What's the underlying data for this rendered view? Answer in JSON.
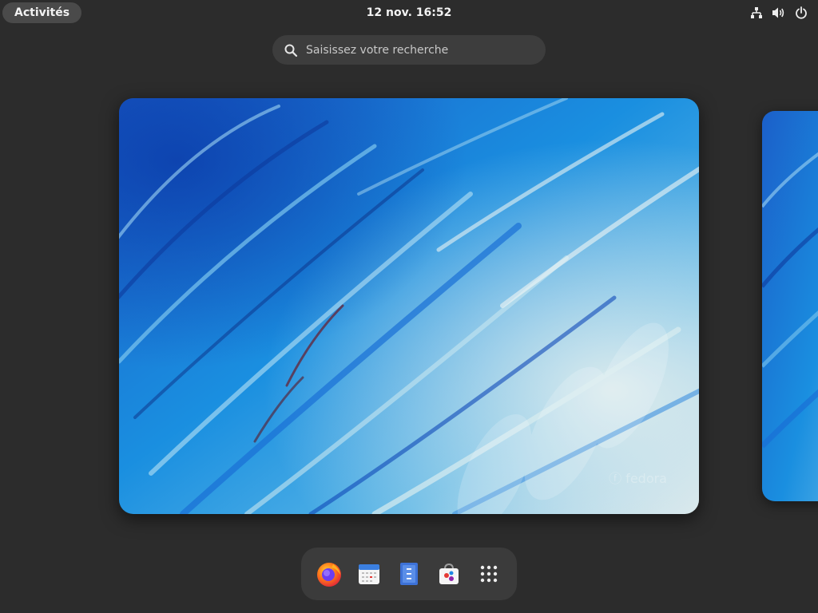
{
  "topbar": {
    "activities_label": "Activités",
    "clock": "12 nov.  16:52",
    "tray_icons": [
      "network-icon",
      "volume-icon",
      "power-icon"
    ]
  },
  "search": {
    "placeholder": "Saisissez votre recherche",
    "value": ""
  },
  "workspaces": {
    "current": {
      "wallpaper": "blue-marbled-waves",
      "watermark": "fedora"
    },
    "next": {
      "wallpaper": "blue-marbled-waves"
    }
  },
  "dash": {
    "items": [
      {
        "name": "firefox-icon"
      },
      {
        "name": "calendar-icon"
      },
      {
        "name": "text-editor-icon"
      },
      {
        "name": "software-icon"
      },
      {
        "name": "show-apps-icon"
      }
    ]
  },
  "colors": {
    "background": "#2c2c2c",
    "panel_pill": "#4a4a4a",
    "search_bg": "#3d3d3d",
    "dash_bg": "#3b3b3b",
    "wallpaper_primary": "#1a73d9",
    "wallpaper_light": "#cfe3ea"
  }
}
